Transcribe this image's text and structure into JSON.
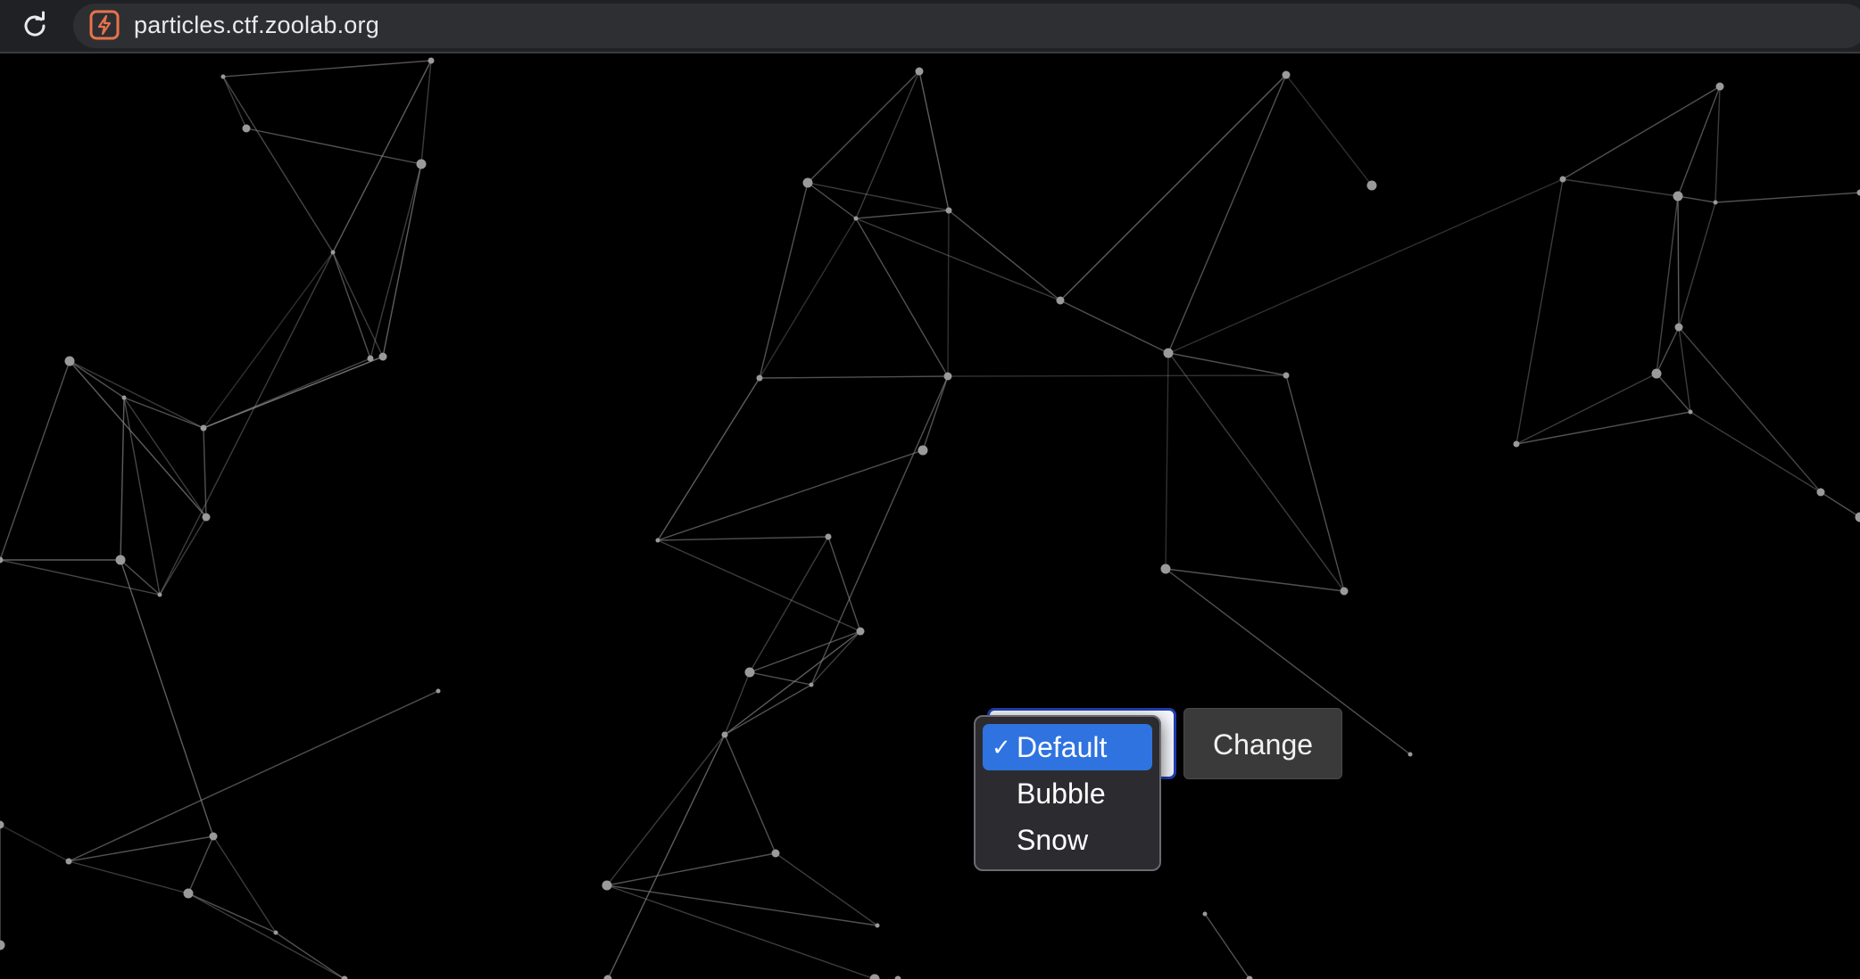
{
  "browser": {
    "url": "particles.ctf.zoolab.org",
    "reload_icon": "reload-icon",
    "site_icon": "lightning-bolt-icon",
    "site_icon_color": "#e8734a"
  },
  "controls": {
    "select_value": "Default",
    "options": [
      {
        "label": "Default",
        "selected": true,
        "check": "✓"
      },
      {
        "label": "Bubble",
        "selected": false,
        "check": ""
      },
      {
        "label": "Snow",
        "selected": false,
        "check": ""
      }
    ],
    "change_label": "Change",
    "highlight_color": "#2f73e0"
  }
}
